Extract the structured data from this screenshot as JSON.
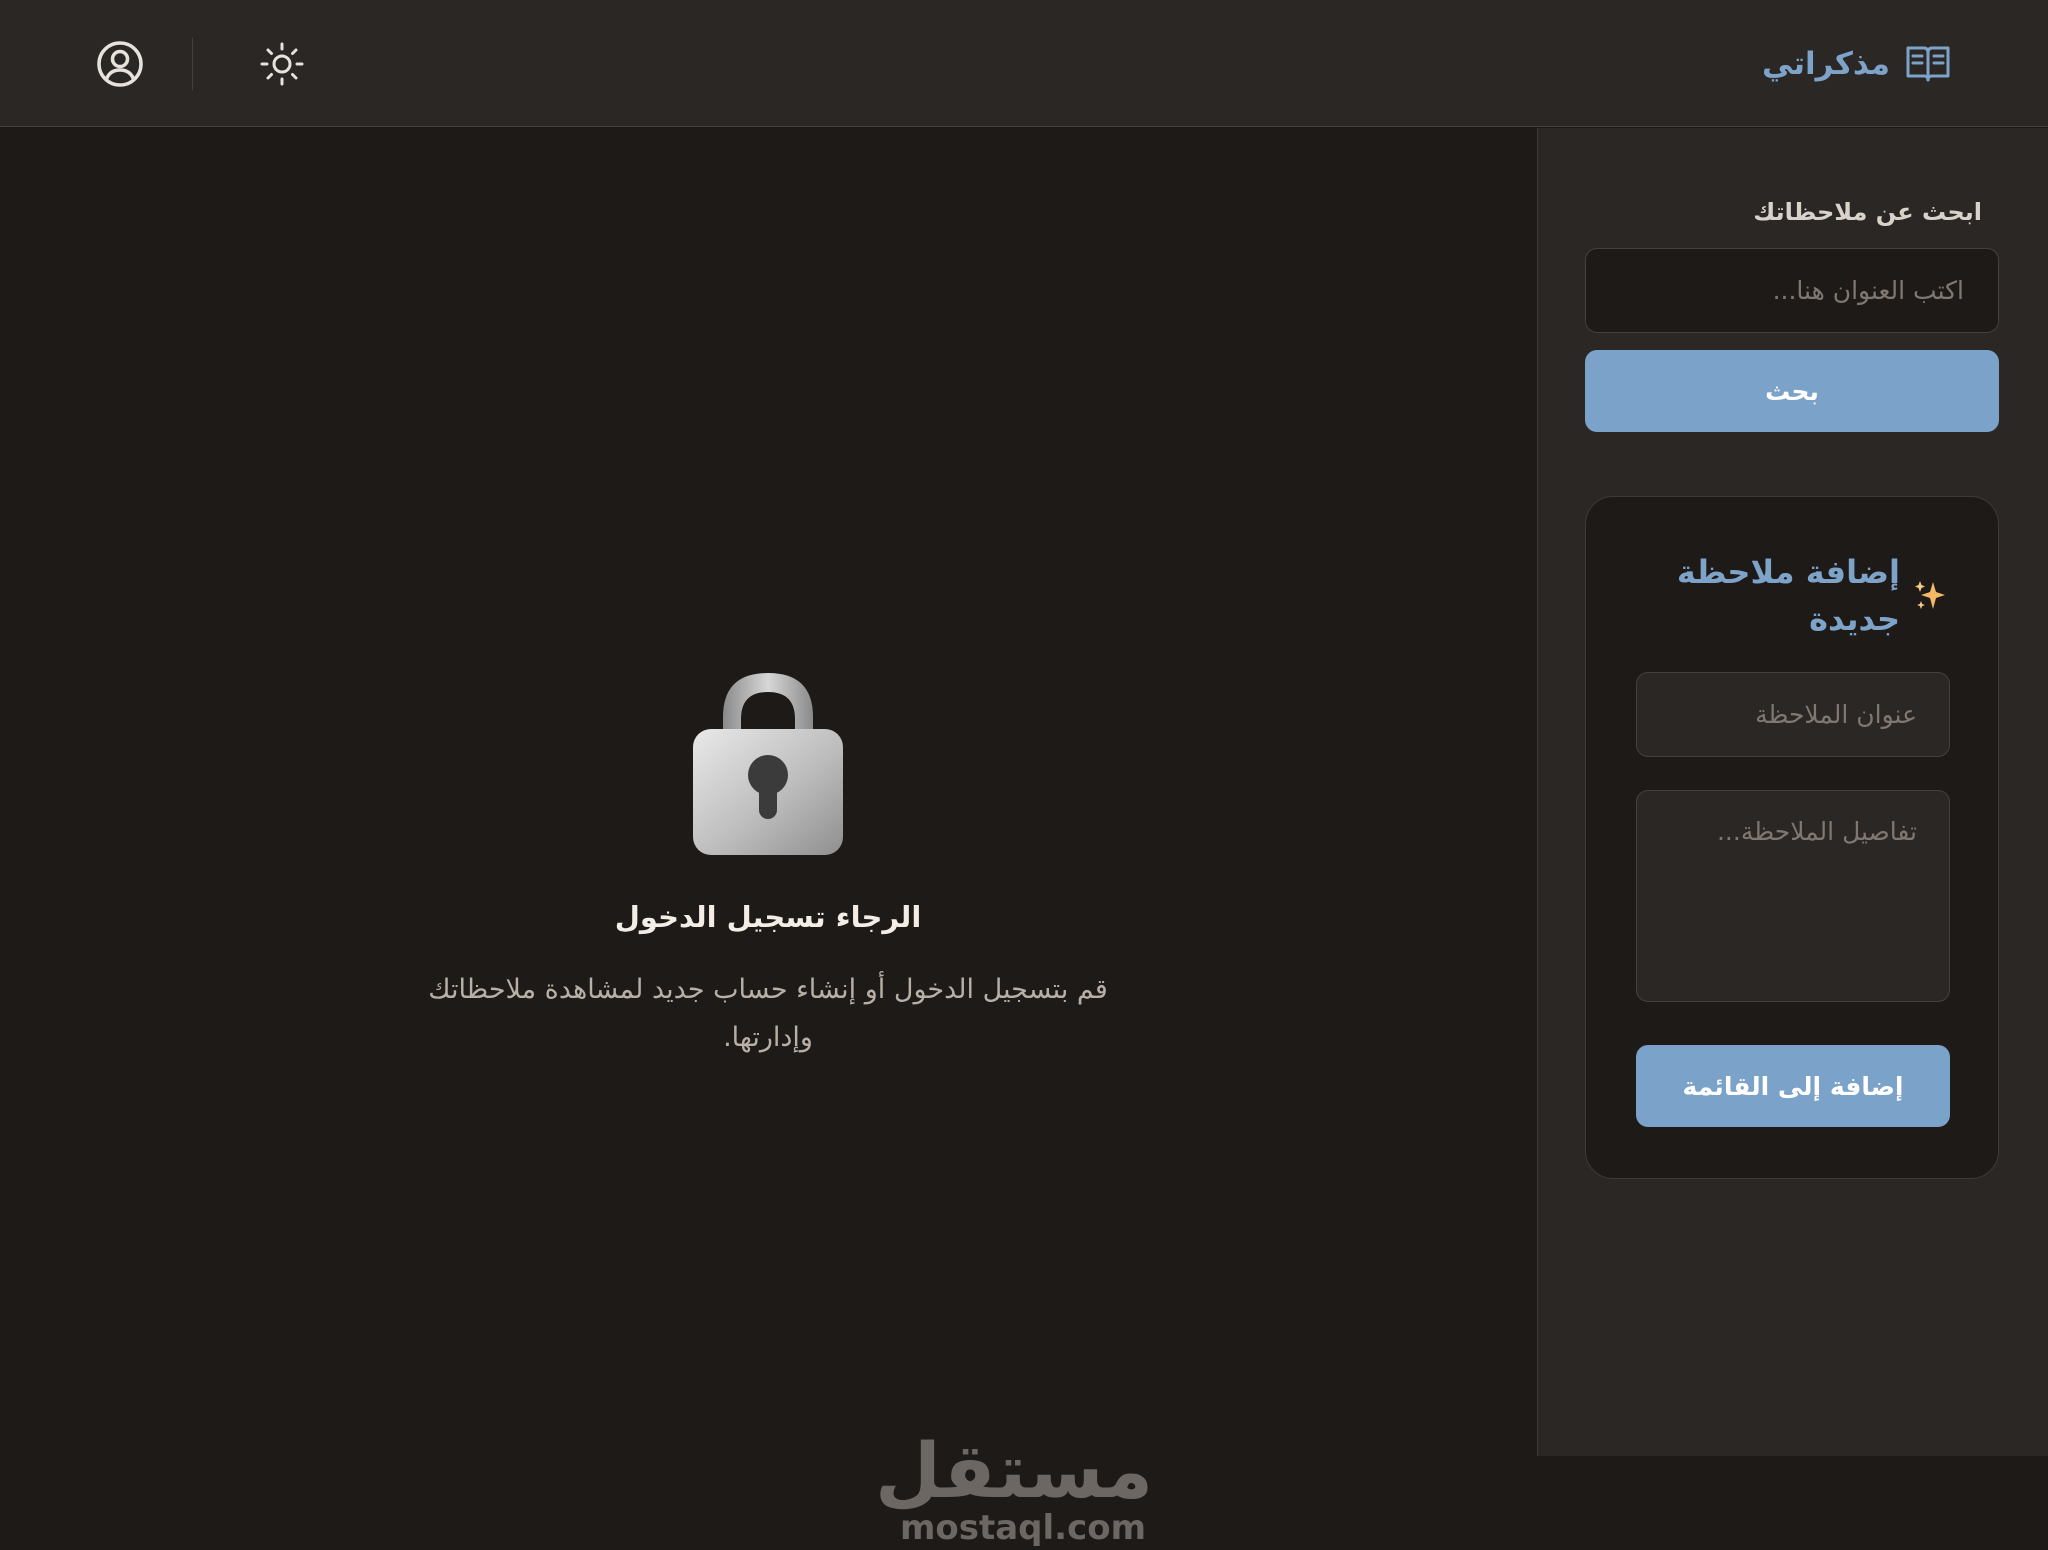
{
  "header": {
    "brand_title": "مذكراتي",
    "brand_icon": "open-book-icon",
    "theme_icon": "sun-icon",
    "user_icon": "user-circle-icon"
  },
  "sidebar": {
    "search_label": "ابحث عن ملاحظاتك",
    "search_placeholder": "اكتب العنوان هنا...",
    "search_button": "بحث",
    "add_note": {
      "title": "إضافة ملاحظة جديدة",
      "title_icon": "sparkles-icon",
      "title_placeholder": "عنوان الملاحظة",
      "details_placeholder": "تفاصيل الملاحظة...",
      "submit_button": "إضافة إلى القائمة"
    }
  },
  "main": {
    "lock_icon": "padlock-icon",
    "login_title": "الرجاء تسجيل الدخول",
    "login_message": "قم بتسجيل الدخول أو إنشاء حساب جديد لمشاهدة ملاحظاتك وإدارتها."
  },
  "watermark": {
    "arabic": "مستقل",
    "latin": "mostaql.com"
  },
  "colors": {
    "accent": "#7ba2c8",
    "background": "#1e1a18",
    "panel": "#2b2725"
  }
}
